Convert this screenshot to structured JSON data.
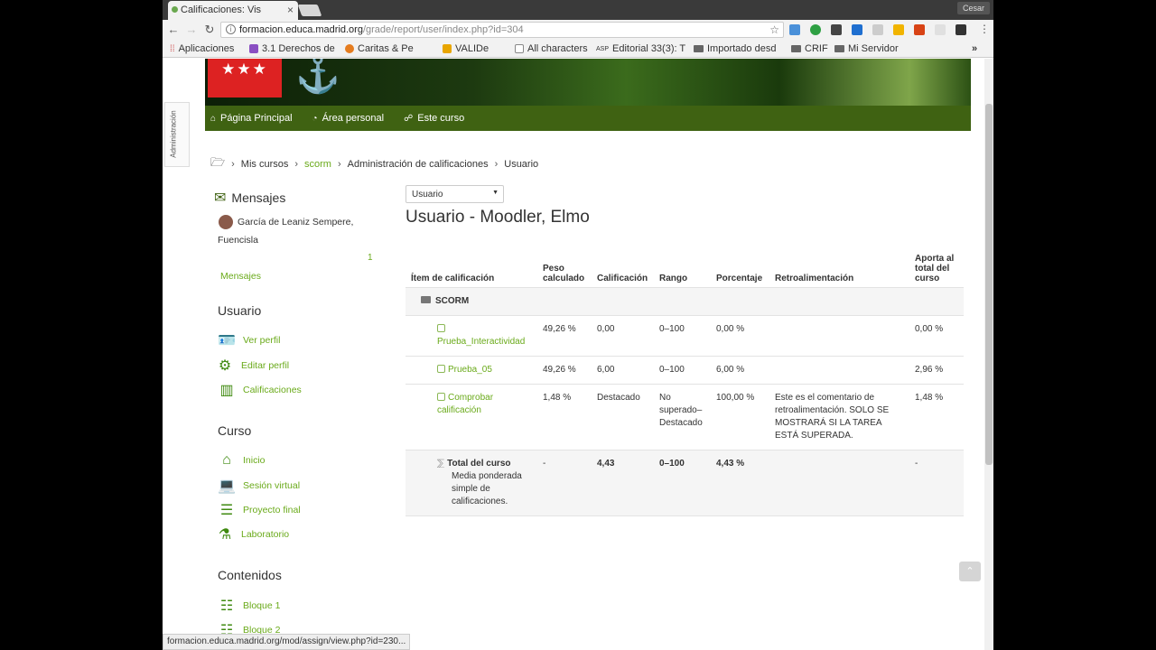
{
  "browser": {
    "tab_title": "Calificaciones: Vis",
    "user": "Cesar",
    "url_host": "formacion.educa.madrid.org",
    "url_path": "/grade/report/user/index.php?id=304",
    "bookmarks": [
      "Aplicaciones",
      "3.1 Derechos de",
      "Caritas & Pe",
      "VALIDe",
      "All characters",
      "Editorial 33(3): T",
      "Importado desd",
      "CRIF",
      "Mi Servidor"
    ],
    "more": "»",
    "status_url": "formacion.educa.madrid.org/mod/assign/view.php?id=230..."
  },
  "site": {
    "logo_stars": "★★★",
    "admin_tab": "Administración",
    "nav": [
      "Página Principal",
      "Área personal",
      "Este curso"
    ]
  },
  "breadcrumb": [
    "Mis cursos",
    "scorm",
    "Administración de calificaciones",
    "Usuario"
  ],
  "messages": {
    "title": "Mensajes",
    "contact": "García de Leaniz Sempere,",
    "contact_line2": "Fuencisla",
    "count": "1",
    "link": "Mensajes"
  },
  "usuario_block": {
    "title": "Usuario",
    "links": [
      "Ver perfil",
      "Editar perfil",
      "Calificaciones"
    ]
  },
  "curso_block": {
    "title": "Curso",
    "links": [
      "Inicio",
      "Sesión virtual",
      "Proyecto final",
      "Laboratorio"
    ]
  },
  "contenidos_block": {
    "title": "Contenidos",
    "links": [
      "Bloque 1",
      "Bloque 2"
    ]
  },
  "report": {
    "select_value": "Usuario",
    "heading": "Usuario - Moodler, Elmo",
    "columns": [
      "Ítem de calificación",
      "Peso calculado",
      "Calificación",
      "Rango",
      "Porcentaje",
      "Retroalimentación",
      "Aporta al total del curso"
    ],
    "category": "SCORM",
    "rows": [
      {
        "item": "Prueba_Interactividad",
        "peso": "49,26 %",
        "calif": "0,00",
        "rango": "0–100",
        "pct": "0,00 %",
        "retro": "",
        "aporta": "0,00 %"
      },
      {
        "item": "Prueba_05",
        "peso": "49,26 %",
        "calif": "6,00",
        "rango": "0–100",
        "pct": "6,00 %",
        "retro": "",
        "aporta": "2,96 %"
      },
      {
        "item": "Comprobar calificación",
        "peso": "1,48 %",
        "calif": "Destacado",
        "rango": "No superado–Destacado",
        "pct": "100,00 %",
        "retro": "Este es el comentario de retroalimentación. SOLO SE MOSTRARÁ SI LA TAREA ESTÁ SUPERADA.",
        "aporta": "1,48 %"
      }
    ],
    "total": {
      "label": "Total del curso",
      "sub": "Media ponderada simple de calificaciones.",
      "peso": "-",
      "calif": "4,43",
      "rango": "0–100",
      "pct": "4,43 %",
      "aporta": "-"
    }
  },
  "colors": {
    "accent": "#6aaa1a",
    "navbar": "#3f6212"
  }
}
